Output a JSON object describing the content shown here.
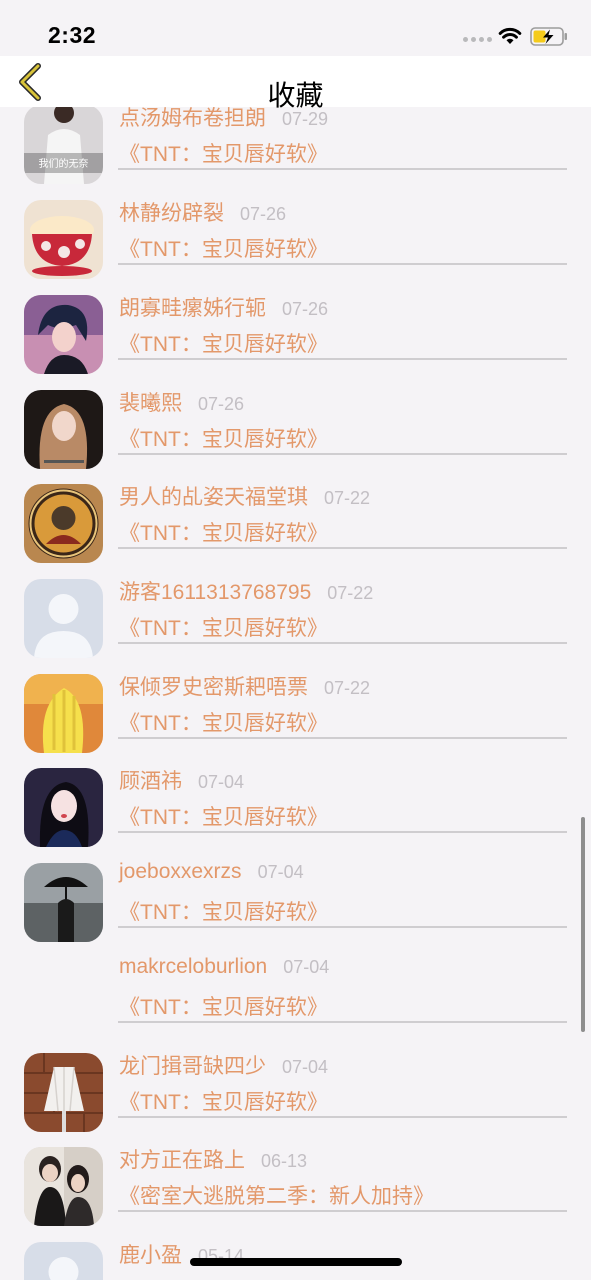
{
  "status": {
    "time": "2:32"
  },
  "nav": {
    "title": "收藏",
    "back_icon": "chevron-left-icon"
  },
  "colors": {
    "accent": "#e3986a",
    "date": "#c3bfc4",
    "background": "#f5f3f6",
    "back_icon": "#c9b43a"
  },
  "items": [
    {
      "name": "点汤姆布卷担朗",
      "date": "07-29",
      "work": "《TNT：宝贝唇好软》",
      "avatar": "avatar-image",
      "avatar_caption": "我们的无奈"
    },
    {
      "name": "林静纷辟裂",
      "date": "07-26",
      "work": "《TNT：宝贝唇好软》",
      "avatar": "teacup-image"
    },
    {
      "name": "朗寡畦瘰姊行轭",
      "date": "07-26",
      "work": "《TNT：宝贝唇好软》",
      "avatar": "anime-boy-image"
    },
    {
      "name": "裴曦熙",
      "date": "07-26",
      "work": "《TNT：宝贝唇好软》",
      "avatar": "girl-portrait-image"
    },
    {
      "name": "男人的乩姿天福堂琪",
      "date": "07-22",
      "work": "《TNT：宝贝唇好软》",
      "avatar": "badge-image"
    },
    {
      "name": "游客1611313768795",
      "date": "07-22",
      "work": "《TNT：宝贝唇好软》",
      "avatar": "default-avatar-image"
    },
    {
      "name": "保倾罗史密斯耙唔票",
      "date": "07-22",
      "work": "《TNT：宝贝唇好软》",
      "avatar": "cactus-image"
    },
    {
      "name": "顾酒祎",
      "date": "07-04",
      "work": "《TNT：宝贝唇好软》",
      "avatar": "girl-selfie-image"
    },
    {
      "name": "joeboxxexrzs",
      "date": "07-04",
      "work": "《TNT：宝贝唇好软》",
      "avatar": "umbrella-image"
    },
    {
      "name": "makrceloburlion",
      "date": "07-04",
      "work": "《TNT：宝贝唇好软》",
      "avatar": "blank-avatar"
    },
    {
      "name": "龙门揖哥缺四少",
      "date": "07-04",
      "work": "《TNT：宝贝唇好软》",
      "avatar": "lamp-image"
    },
    {
      "name": "对方正在路上",
      "date": "06-13",
      "work": "《密室大逃脱第二季：新人加持》",
      "avatar": "couple-image"
    },
    {
      "name": "鹿小盈",
      "date": "05-14",
      "work": "",
      "avatar": "default-avatar-image"
    }
  ]
}
